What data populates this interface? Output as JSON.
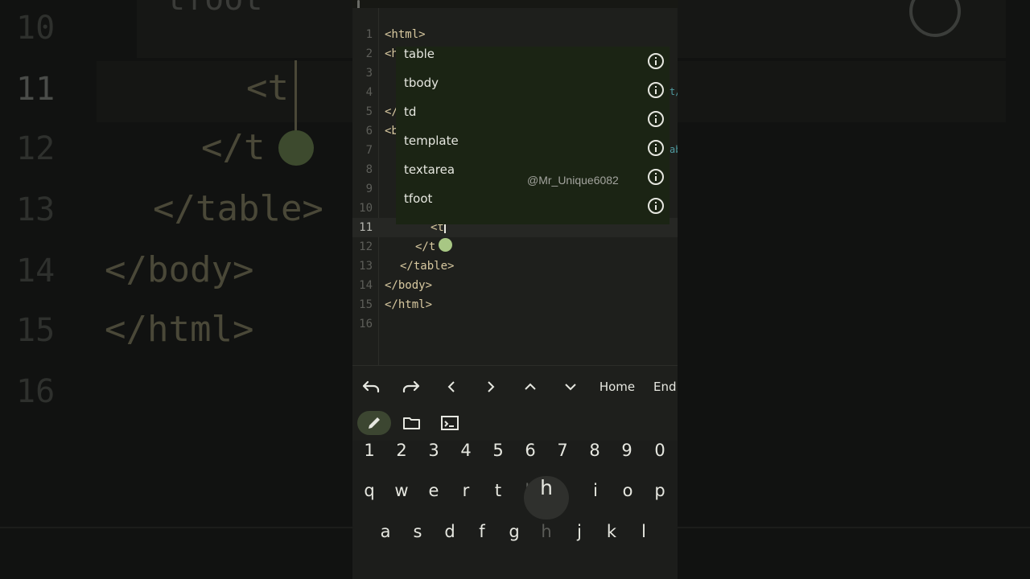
{
  "editor": {
    "line_numbers": [
      "1",
      "2",
      "3",
      "4",
      "5",
      "6",
      "7",
      "8",
      "9",
      "10",
      "11",
      "12",
      "13",
      "14",
      "15",
      "16"
    ],
    "current_line": "11",
    "lines": {
      "l1": "<html>",
      "l2": "<h",
      "l5": "</",
      "l6": "<b",
      "l11": "<t",
      "l12": "</t",
      "l13": "</table>",
      "l14": "</body>",
      "l15": "</html>"
    },
    "fragments": {
      "f4": "t/",
      "f7": "ab"
    }
  },
  "autocomplete": {
    "items": [
      "table",
      "tbody",
      "td",
      "template",
      "textarea",
      "tfoot"
    ]
  },
  "watermark": "@Mr_Unique6082",
  "toolbar": {
    "home_label": "Home",
    "end_label": "End"
  },
  "keyboard": {
    "numbers": [
      "1",
      "2",
      "3",
      "4",
      "5",
      "6",
      "7",
      "8",
      "9",
      "0"
    ],
    "row1": [
      "q",
      "w",
      "e",
      "r",
      "t",
      "h",
      "i",
      "o",
      "p"
    ],
    "row2": [
      "a",
      "s",
      "d",
      "f",
      "g",
      "h",
      "j",
      "k",
      "l"
    ],
    "popup_key": "h"
  },
  "backdrop": {
    "line_numbers": [
      "10",
      "11",
      "12",
      "13",
      "14",
      "15",
      "16"
    ],
    "top_text": "tfoot",
    "code_11": "<t",
    "code_12": "</t",
    "code_13": "</table>",
    "code_14": "</body>",
    "code_15": "</html>"
  },
  "colors": {
    "accent": "#a8c784",
    "popup_bg": "#1b2414",
    "editor_bg": "#1e1f1c"
  }
}
